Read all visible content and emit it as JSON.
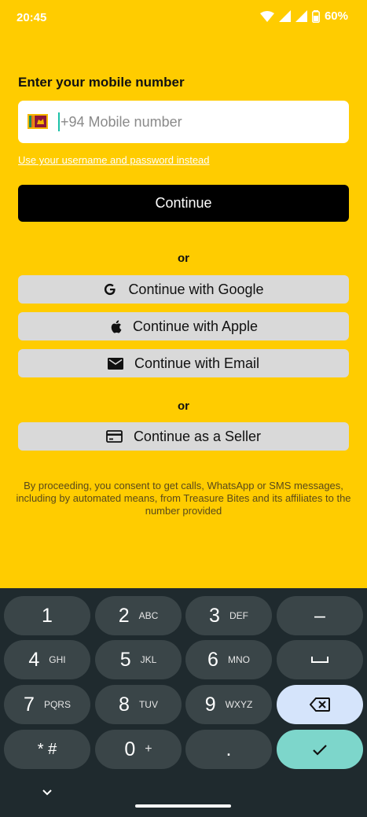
{
  "status_bar": {
    "time": "20:45",
    "battery": "60%"
  },
  "login": {
    "heading": "Enter your mobile number",
    "phone_placeholder": "+94 Mobile number",
    "country_flag_icon": "sri-lanka-flag-icon",
    "alt_link": "Use your username and password instead",
    "continue_label": "Continue",
    "or_label_1": "or",
    "google_label": "Continue with Google",
    "apple_label": "Continue with Apple",
    "email_label": "Continue with Email",
    "or_label_2": "or",
    "seller_label": "Continue as a Seller",
    "disclaimer": "By proceeding, you consent to get calls, WhatsApp or SMS messages, including by automated means, from Treasure Bites and its affiliates to the number provided"
  },
  "colors": {
    "background": "#FFCC00",
    "button_dark": "#000000",
    "button_light": "#D9D9D9",
    "keyboard_bg": "#1F2A2E"
  },
  "keyboard": {
    "keys": [
      {
        "main": "1",
        "sub": ""
      },
      {
        "main": "2",
        "sub": "ABC"
      },
      {
        "main": "3",
        "sub": "DEF"
      },
      {
        "main": "–",
        "sub": ""
      },
      {
        "main": "4",
        "sub": "GHI"
      },
      {
        "main": "5",
        "sub": "JKL"
      },
      {
        "main": "6",
        "sub": "MNO"
      },
      {
        "main": "␣",
        "sub": ""
      },
      {
        "main": "7",
        "sub": "PQRS"
      },
      {
        "main": "8",
        "sub": "TUV"
      },
      {
        "main": "9",
        "sub": "WXYZ"
      },
      {
        "main": "⌫",
        "sub": ""
      },
      {
        "main": "* #",
        "sub": ""
      },
      {
        "main": "0",
        "sub": "+"
      },
      {
        "main": ".",
        "sub": ""
      },
      {
        "main": "✓",
        "sub": ""
      }
    ]
  }
}
